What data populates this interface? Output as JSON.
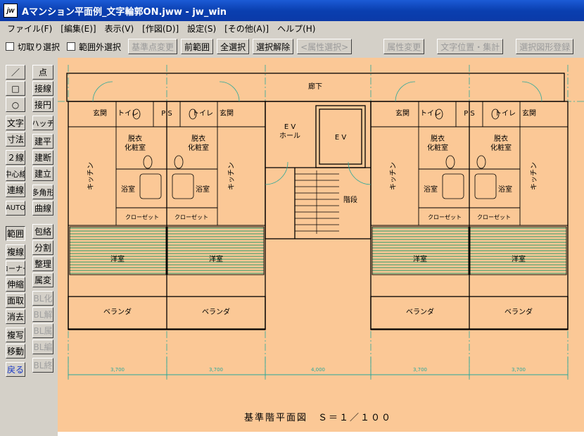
{
  "window": {
    "title": "Aマンション平面例_文字輪郭ON.jww - jw_win",
    "icon": "jw"
  },
  "menu": [
    "ファイル(F)",
    "[編集(E)]",
    "表示(V)",
    "[作図(D)]",
    "設定(S)",
    "[その他(A)]",
    "ヘルプ(H)"
  ],
  "toolbar": {
    "checkbox_crop": "切取り選択",
    "checkbox_outside": "範囲外選択",
    "buttons": [
      "基準点変更",
      "前範囲",
      "全選択",
      "選択解除",
      "<属性選択>",
      "属性変更",
      "文字位置・集計",
      "選択図形登録"
    ]
  },
  "sidebar": {
    "col1": [
      "／",
      "□",
      "○",
      "文字",
      "寸法",
      "２線",
      "中心線",
      "連線",
      "AUTO",
      "範囲",
      "複線",
      "コーナー",
      "伸縮",
      "面取",
      "消去",
      "複写",
      "移動",
      "戻る"
    ],
    "col2": [
      "点",
      "接線",
      "接円",
      "ハッチ",
      "建平",
      "建断",
      "建立",
      "多角形",
      "曲線",
      "包絡",
      "分割",
      "整理",
      "属変",
      "BL化",
      "BL解",
      "BL属",
      "BL編",
      "BL終"
    ]
  },
  "drawing": {
    "corridor": "廊下",
    "entrance": "玄関",
    "toilet": "トイレ",
    "ps": "P S",
    "dressing": [
      "脱衣",
      "化粧室"
    ],
    "kitchen": "キッチン",
    "bath": "浴室",
    "closet": "クローゼット",
    "western_room": "洋室",
    "veranda": "ベランダ",
    "ev_hall": [
      "E V",
      "ホール"
    ],
    "ev": "E V",
    "stairs": "階段",
    "dimensions": [
      "3,700",
      "3,700",
      "4,000",
      "3,700",
      "3,700"
    ],
    "plan_title": "基準階平面図　Ｓ＝１／１００"
  }
}
